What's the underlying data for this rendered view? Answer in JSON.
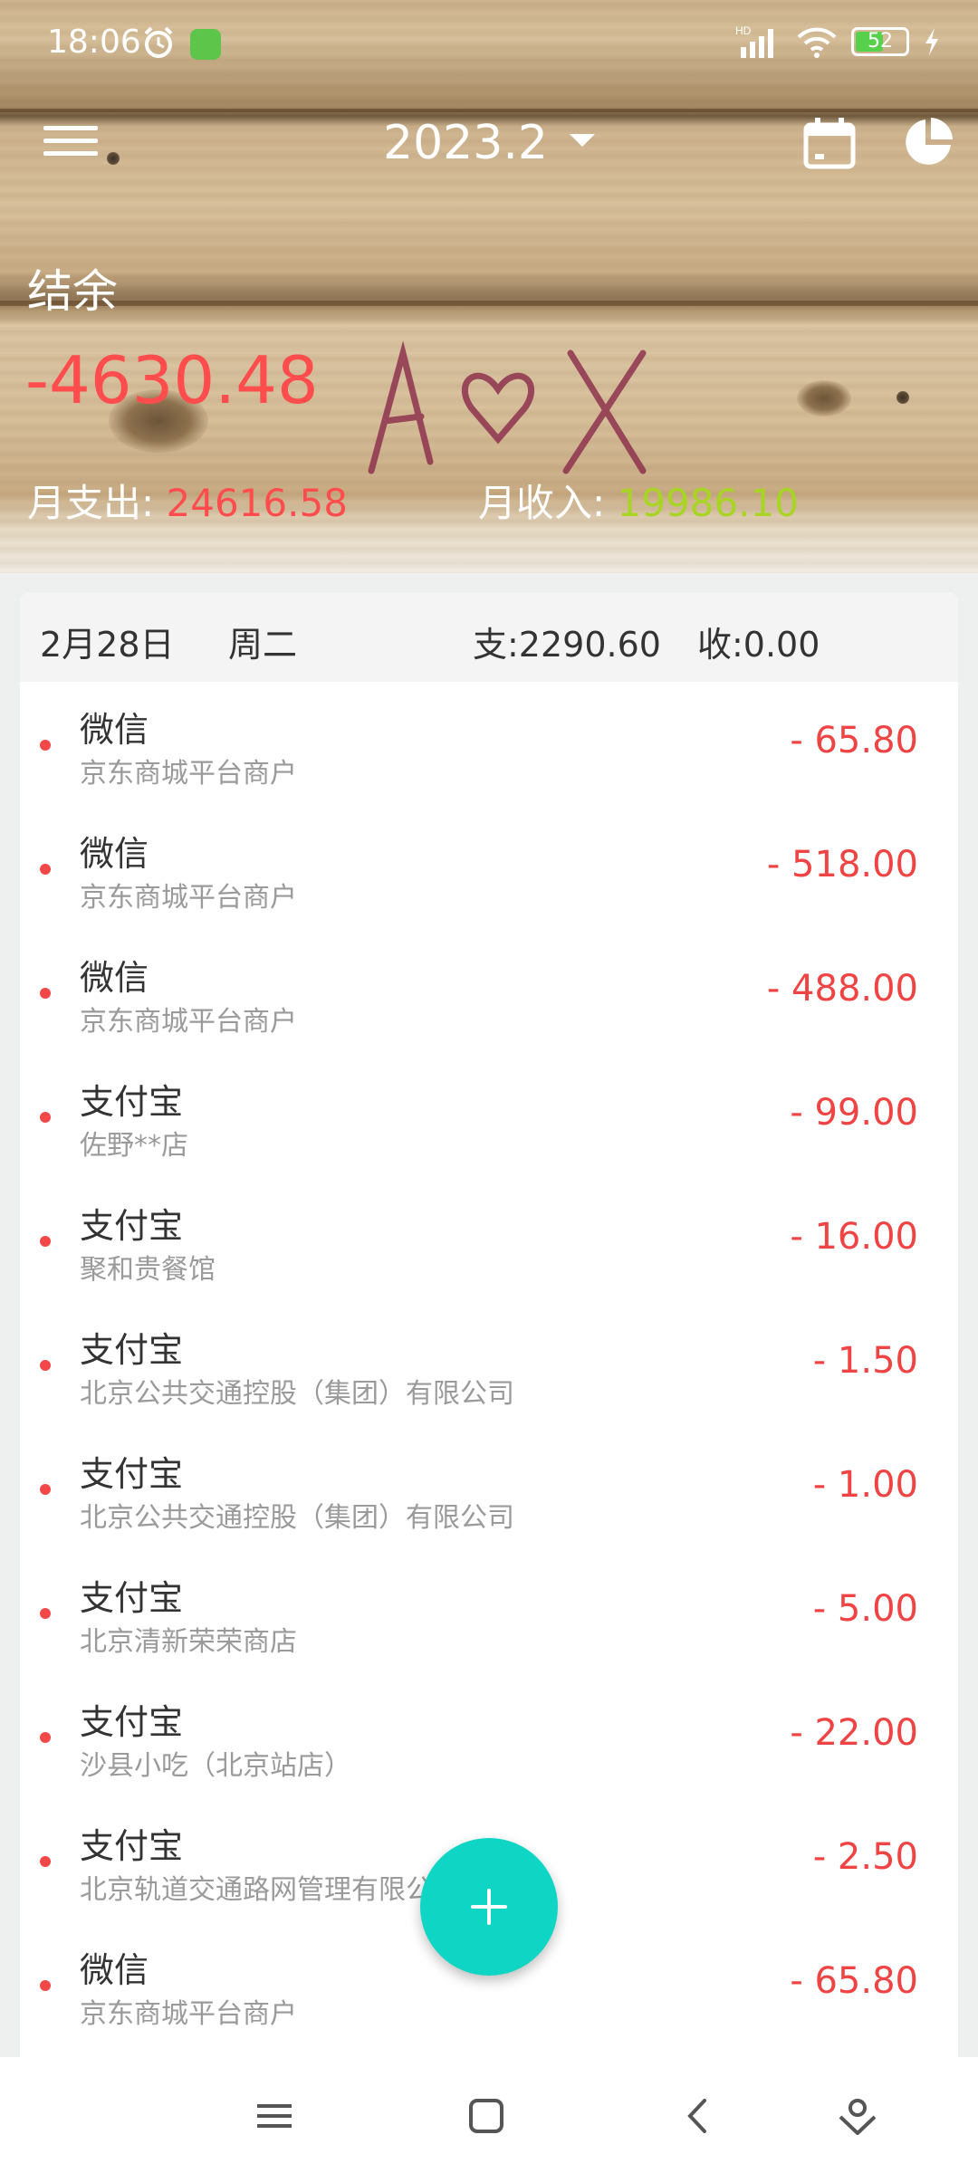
{
  "status_bar": {
    "time": "18:06",
    "battery": "52",
    "network": "HD"
  },
  "toolbar": {
    "title": "2023.2"
  },
  "summary": {
    "balance_label": "结余",
    "balance_value": "-4630.48",
    "expense_label": "月支出:",
    "expense_value": "24616.58",
    "income_label": "月收入:",
    "income_value": "19986.10"
  },
  "day": {
    "date": "2月28日",
    "weekday": "周二",
    "expense": "支:2290.60",
    "income": "收:0.00"
  },
  "transactions": [
    {
      "name": "微信",
      "desc": "京东商城平台商户",
      "amount": "- 65.80"
    },
    {
      "name": "微信",
      "desc": "京东商城平台商户",
      "amount": "- 518.00"
    },
    {
      "name": "微信",
      "desc": "京东商城平台商户",
      "amount": "- 488.00"
    },
    {
      "name": "支付宝",
      "desc": "佐野**店",
      "amount": "- 99.00"
    },
    {
      "name": "支付宝",
      "desc": "聚和贵餐馆",
      "amount": "- 16.00"
    },
    {
      "name": "支付宝",
      "desc": "北京公共交通控股（集团）有限公司",
      "amount": "- 1.50"
    },
    {
      "name": "支付宝",
      "desc": "北京公共交通控股（集团）有限公司",
      "amount": "- 1.00"
    },
    {
      "name": "支付宝",
      "desc": "北京清新荣荣商店",
      "amount": "- 5.00"
    },
    {
      "name": "支付宝",
      "desc": "沙县小吃（北京站店）",
      "amount": "- 22.00"
    },
    {
      "name": "支付宝",
      "desc": "北京轨道交通路网管理有限公司",
      "amount": "- 2.50"
    },
    {
      "name": "微信",
      "desc": "京东商城平台商户",
      "amount": "- 65.80"
    }
  ],
  "colors": {
    "expense": "#f04444",
    "income": "#a8d523",
    "accent": "#0fd5c5"
  }
}
